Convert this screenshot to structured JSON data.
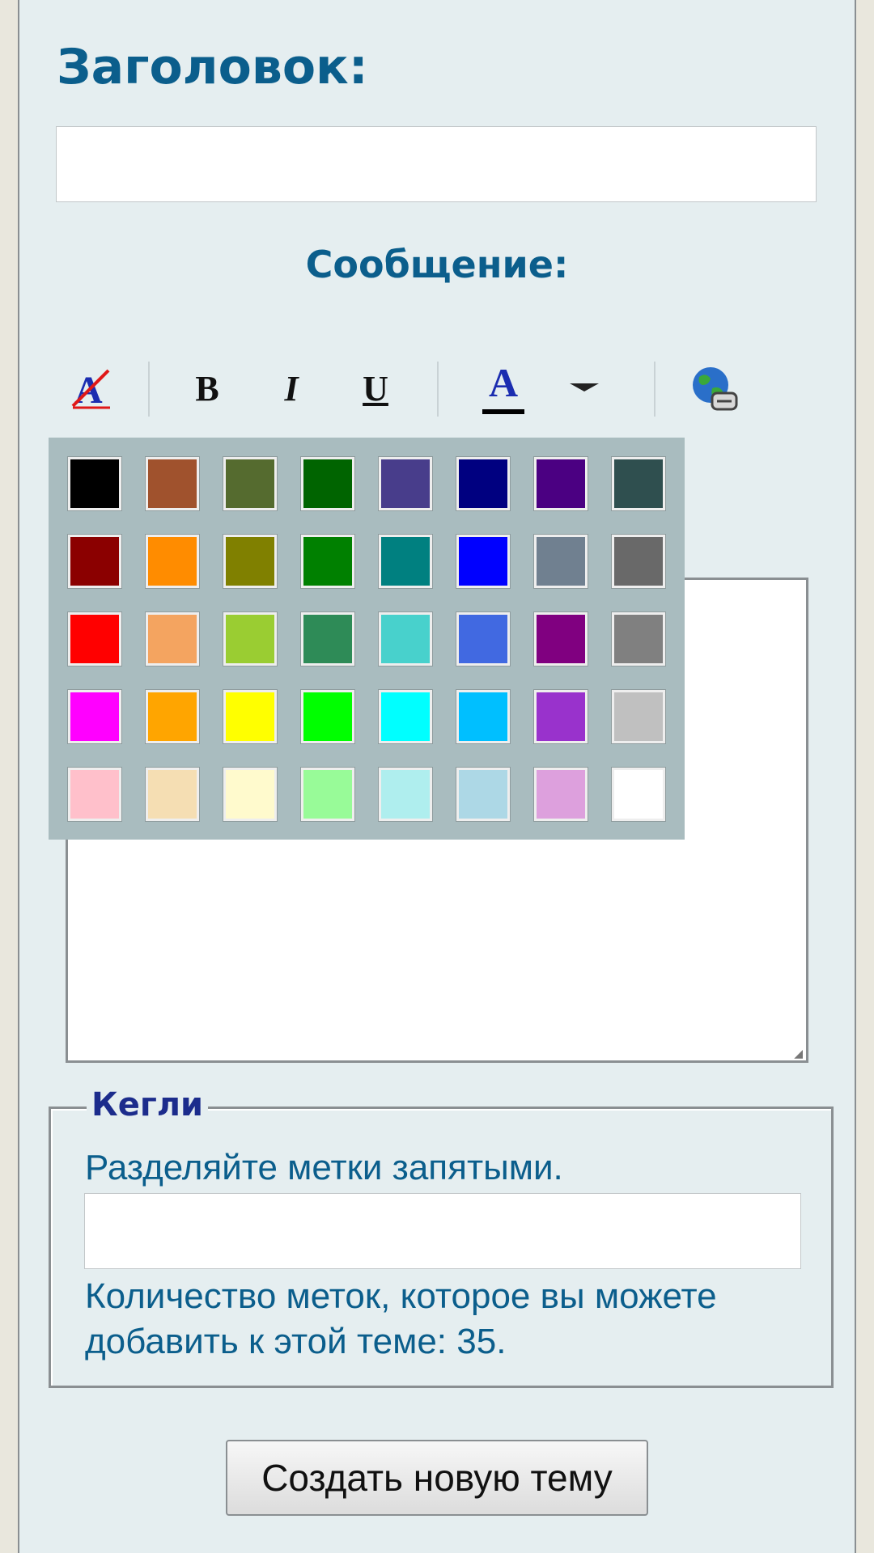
{
  "form": {
    "title_label": "Заголовок:",
    "title_value": "",
    "message_label": "Сообщение:",
    "submit_label": "Создать новую тему"
  },
  "toolbar": {
    "buttons": [
      {
        "name": "remove-format",
        "icon": "remove-format-icon"
      },
      {
        "name": "bold",
        "glyph": "B"
      },
      {
        "name": "italic",
        "glyph": "I"
      },
      {
        "name": "underline",
        "glyph": "U"
      },
      {
        "name": "font-color",
        "glyph": "A",
        "indicator_color": "#000000"
      },
      {
        "name": "font-color-dropdown",
        "icon": "caret-down-icon"
      },
      {
        "name": "insert-link",
        "icon": "globe-link-icon"
      }
    ]
  },
  "color_palette": {
    "rows": [
      [
        "#000000",
        "#a0522d",
        "#556b2f",
        "#006400",
        "#483d8b",
        "#000080",
        "#4b0082",
        "#2f4f4f"
      ],
      [
        "#8b0000",
        "#ff8c00",
        "#808000",
        "#008000",
        "#008080",
        "#0000ff",
        "#708090",
        "#696969"
      ],
      [
        "#ff0000",
        "#f4a460",
        "#9acd32",
        "#2e8b57",
        "#48d1cc",
        "#4169e1",
        "#800080",
        "#808080"
      ],
      [
        "#ff00ff",
        "#ffa500",
        "#ffff00",
        "#00ff00",
        "#00ffff",
        "#00bfff",
        "#9932cc",
        "#c0c0c0"
      ],
      [
        "#ffc0cb",
        "#f5deb3",
        "#fffacd",
        "#98fb98",
        "#afeeee",
        "#add8e6",
        "#dda0dd",
        "#ffffff"
      ]
    ]
  },
  "tags": {
    "legend": "Кегли",
    "hint": "Разделяйте метки запятыми.",
    "value": "",
    "count_text": "Количество меток, которое вы можете добавить к этой теме: 35."
  },
  "colors": {
    "heading": "#0b5e8c",
    "legend": "#1c2c8c",
    "panel_bg": "#e5eef0",
    "palette_bg": "#a9bcbf"
  }
}
